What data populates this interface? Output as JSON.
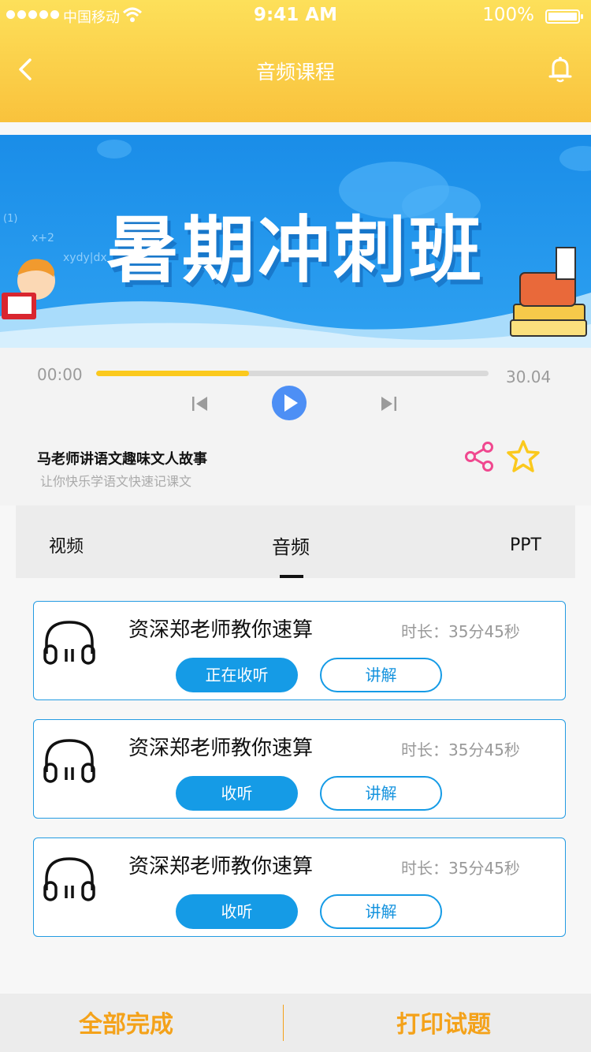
{
  "status_bar": {
    "carrier": "中国移动",
    "time": "9:41 AM",
    "battery": "100%"
  },
  "nav": {
    "title": "音频课程"
  },
  "banner": {
    "text": "暑期冲刺班",
    "background_color": "#1e92ea"
  },
  "player": {
    "current_time": "00:00",
    "total_time": "30.04",
    "progress_fraction": 0.39,
    "progress_color": "#fbc91d"
  },
  "course": {
    "title": "马老师讲语文趣味文人故事",
    "subtitle": "让你快乐学语文快速记课文"
  },
  "tabs": [
    {
      "label": "视频"
    },
    {
      "label": "音频"
    },
    {
      "label": "PPT"
    }
  ],
  "lessons": [
    {
      "name": "资深郑老师教你速算",
      "duration": "时长：35分45秒",
      "listen_label": "正在收听",
      "explain_label": "讲解"
    },
    {
      "name": "资深郑老师教你速算",
      "duration": "时长：35分45秒",
      "listen_label": "收听",
      "explain_label": "讲解"
    },
    {
      "name": "资深郑老师教你速算",
      "duration": "时长：35分45秒",
      "listen_label": "收听",
      "explain_label": "讲解"
    }
  ],
  "footer": {
    "complete_label": "全部完成",
    "print_label": "打印试题"
  },
  "colors": {
    "header_yellow": "#fbd14a",
    "accent_blue": "#159be6",
    "footer_orange": "#f4a21a",
    "share_pink": "#f0488f",
    "star_yellow": "#fbc91d"
  }
}
